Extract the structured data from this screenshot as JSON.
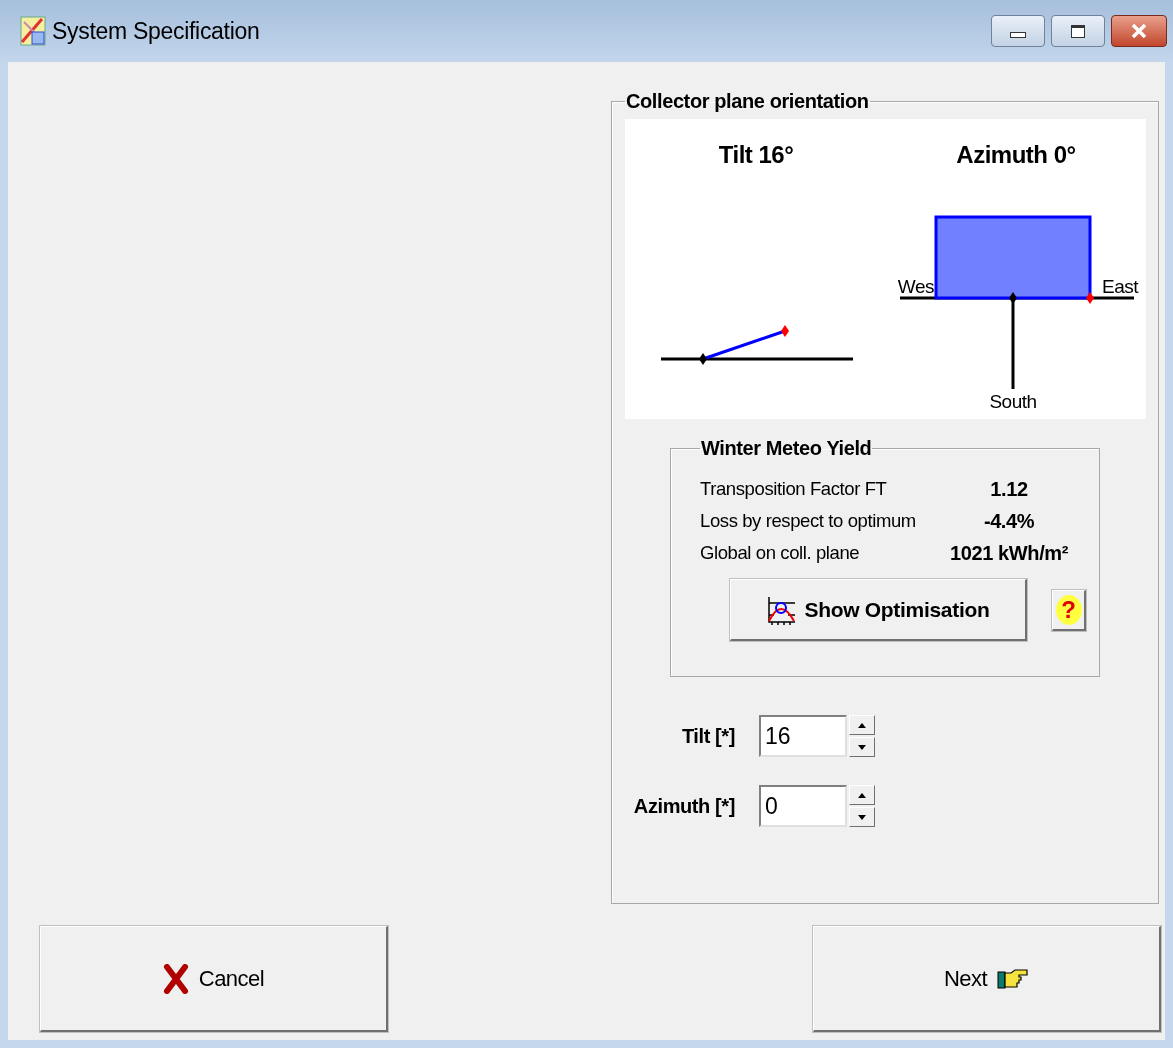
{
  "window": {
    "title": "System Specification"
  },
  "orientation_group": {
    "title": "Collector plane orientation",
    "diagram": {
      "tilt_title": "Tilt 16°",
      "azimuth_title": "Azimuth 0°",
      "west_label": "Wes",
      "east_label": "East",
      "south_label": "South"
    }
  },
  "meteo_group": {
    "title": "Winter Meteo Yield",
    "rows": [
      {
        "label": "Transposition Factor FT",
        "value": "1.12"
      },
      {
        "label": "Loss by respect to optimum",
        "value": "-4.4%"
      },
      {
        "label": "Global  on coll. plane",
        "value": "1021 kWh/m²"
      }
    ],
    "show_button": {
      "label": "Show Optimisation"
    },
    "help_button": {
      "label": "?"
    }
  },
  "fields": [
    {
      "label": "Tilt [*]",
      "value": "16"
    },
    {
      "label": "Azimuth [*]",
      "value": "0"
    }
  ],
  "buttons": [
    {
      "label": "Cancel",
      "kind": "cancel"
    },
    {
      "label": "Next",
      "kind": "next"
    }
  ]
}
